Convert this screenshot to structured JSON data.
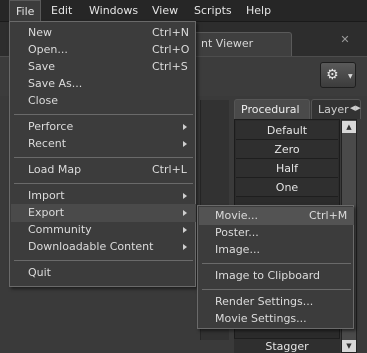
{
  "menubar": {
    "items": [
      "File",
      "Edit",
      "Windows",
      "View",
      "Scripts",
      "Help"
    ]
  },
  "viewer_tab": {
    "label": "nt Viewer"
  },
  "right_panel": {
    "tabs": [
      "Procedural",
      "Layer"
    ],
    "presets": [
      "Default",
      "Zero",
      "Half",
      "One"
    ],
    "bottom_item": "Stagger"
  },
  "file_menu": {
    "groups": [
      [
        {
          "label": "New",
          "shortcut": "Ctrl+N"
        },
        {
          "label": "Open...",
          "shortcut": "Ctrl+O"
        },
        {
          "label": "Save",
          "shortcut": "Ctrl+S"
        },
        {
          "label": "Save As...",
          "shortcut": ""
        },
        {
          "label": "Close",
          "shortcut": ""
        }
      ],
      [
        {
          "label": "Perforce",
          "submenu": true
        },
        {
          "label": "Recent",
          "submenu": true
        }
      ],
      [
        {
          "label": "Load Map",
          "shortcut": "Ctrl+L"
        }
      ],
      [
        {
          "label": "Import",
          "submenu": true
        },
        {
          "label": "Export",
          "submenu": true,
          "highlighted": true
        },
        {
          "label": "Community",
          "submenu": true
        },
        {
          "label": "Downloadable Content",
          "submenu": true
        }
      ],
      [
        {
          "label": "Quit",
          "shortcut": ""
        }
      ]
    ]
  },
  "export_menu": {
    "groups": [
      [
        {
          "label": "Movie...",
          "shortcut": "Ctrl+M",
          "highlighted": true
        },
        {
          "label": "Poster...",
          "shortcut": ""
        },
        {
          "label": "Image...",
          "shortcut": ""
        }
      ],
      [
        {
          "label": "Image to Clipboard",
          "shortcut": ""
        }
      ],
      [
        {
          "label": "Render Settings...",
          "shortcut": ""
        },
        {
          "label": "Movie Settings...",
          "shortcut": ""
        }
      ]
    ]
  }
}
